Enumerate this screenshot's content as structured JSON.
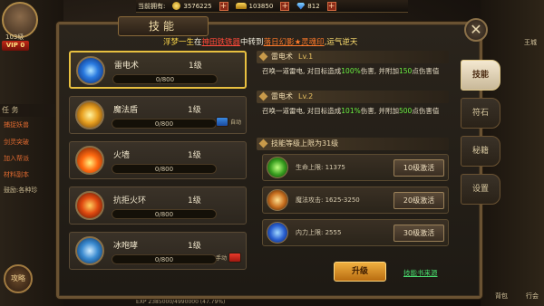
{
  "hud": {
    "holding_label": "当前拥有:",
    "gold": "3576225",
    "ingot": "103850",
    "diamond": "812",
    "player_level": "103级",
    "vip": "VIP 0",
    "tab_task": "任 务",
    "quests": [
      "捕捉妖兽",
      "剑灵突破",
      "加入帮派",
      "材料副本",
      "鼓励:各种珍"
    ],
    "round_button": "攻略",
    "exp": "EXP 2385000/4990000   (47.79%)",
    "right_top": "王城",
    "right_bottom_1": "背包",
    "right_bottom_2": "行会"
  },
  "panel": {
    "title": "技能",
    "close": "✕",
    "announce": {
      "p1": "浮梦一生",
      "p2": "在",
      "p3": "神田铁铁器",
      "p4": "中转到",
      "p5": "落日幻影★灵魂印",
      "p6": ",运气逆天"
    }
  },
  "skills": [
    {
      "name": "雷电术",
      "level": "1级",
      "progress": "0/800",
      "icon": "thunder-icon",
      "active": true
    },
    {
      "name": "魔法盾",
      "level": "1级",
      "progress": "0/800",
      "icon": "shield-icon",
      "toggle": "自动",
      "toggle_state": "on"
    },
    {
      "name": "火墙",
      "level": "1级",
      "progress": "0/800",
      "icon": "fire-icon"
    },
    {
      "name": "抗拒火环",
      "level": "1级",
      "progress": "0/800",
      "icon": "ring-icon"
    },
    {
      "name": "冰咆哮",
      "level": "1级",
      "progress": "0/800",
      "icon": "roar-icon",
      "toggle": "手动",
      "toggle_state": "off"
    }
  ],
  "detail": {
    "cur_name": "雷电术",
    "cur_lv": "Lv.1",
    "cur_desc_1": "召唤一道雷电, 对目标造成",
    "cur_pct": "100%",
    "cur_desc_2": "伤害, 并附加",
    "cur_add": "150",
    "cur_desc_3": "点伤害值",
    "next_name": "雷电术",
    "next_lv": "Lv.2",
    "next_desc_1": "召唤一道雷电, 对目标造成",
    "next_pct": "101%",
    "next_desc_2": "伤害, 并附加",
    "next_add": "500",
    "next_desc_3": "点伤害值",
    "cap_head": "技能等级上限为31级",
    "upgrades": [
      {
        "text": "生命上限: 11375",
        "button": "10级激活",
        "icon": "life-icon"
      },
      {
        "text": "魔法攻击: 1625-3250",
        "button": "20级激活",
        "icon": "magic-attack-icon"
      },
      {
        "text": "内力上限: 2555",
        "button": "30级激活",
        "icon": "inner-power-icon"
      }
    ],
    "upgrade_button": "升级",
    "source_link": "技能书来源"
  },
  "tabs": [
    {
      "label": "技能",
      "active": true
    },
    {
      "label": "符石"
    },
    {
      "label": "秘籍"
    },
    {
      "label": "设置"
    }
  ],
  "colors": {
    "accent": "#e8c040",
    "highlight_green": "#6af040",
    "toggle_on": "#2a6ad0",
    "toggle_off": "#e83a2a"
  }
}
